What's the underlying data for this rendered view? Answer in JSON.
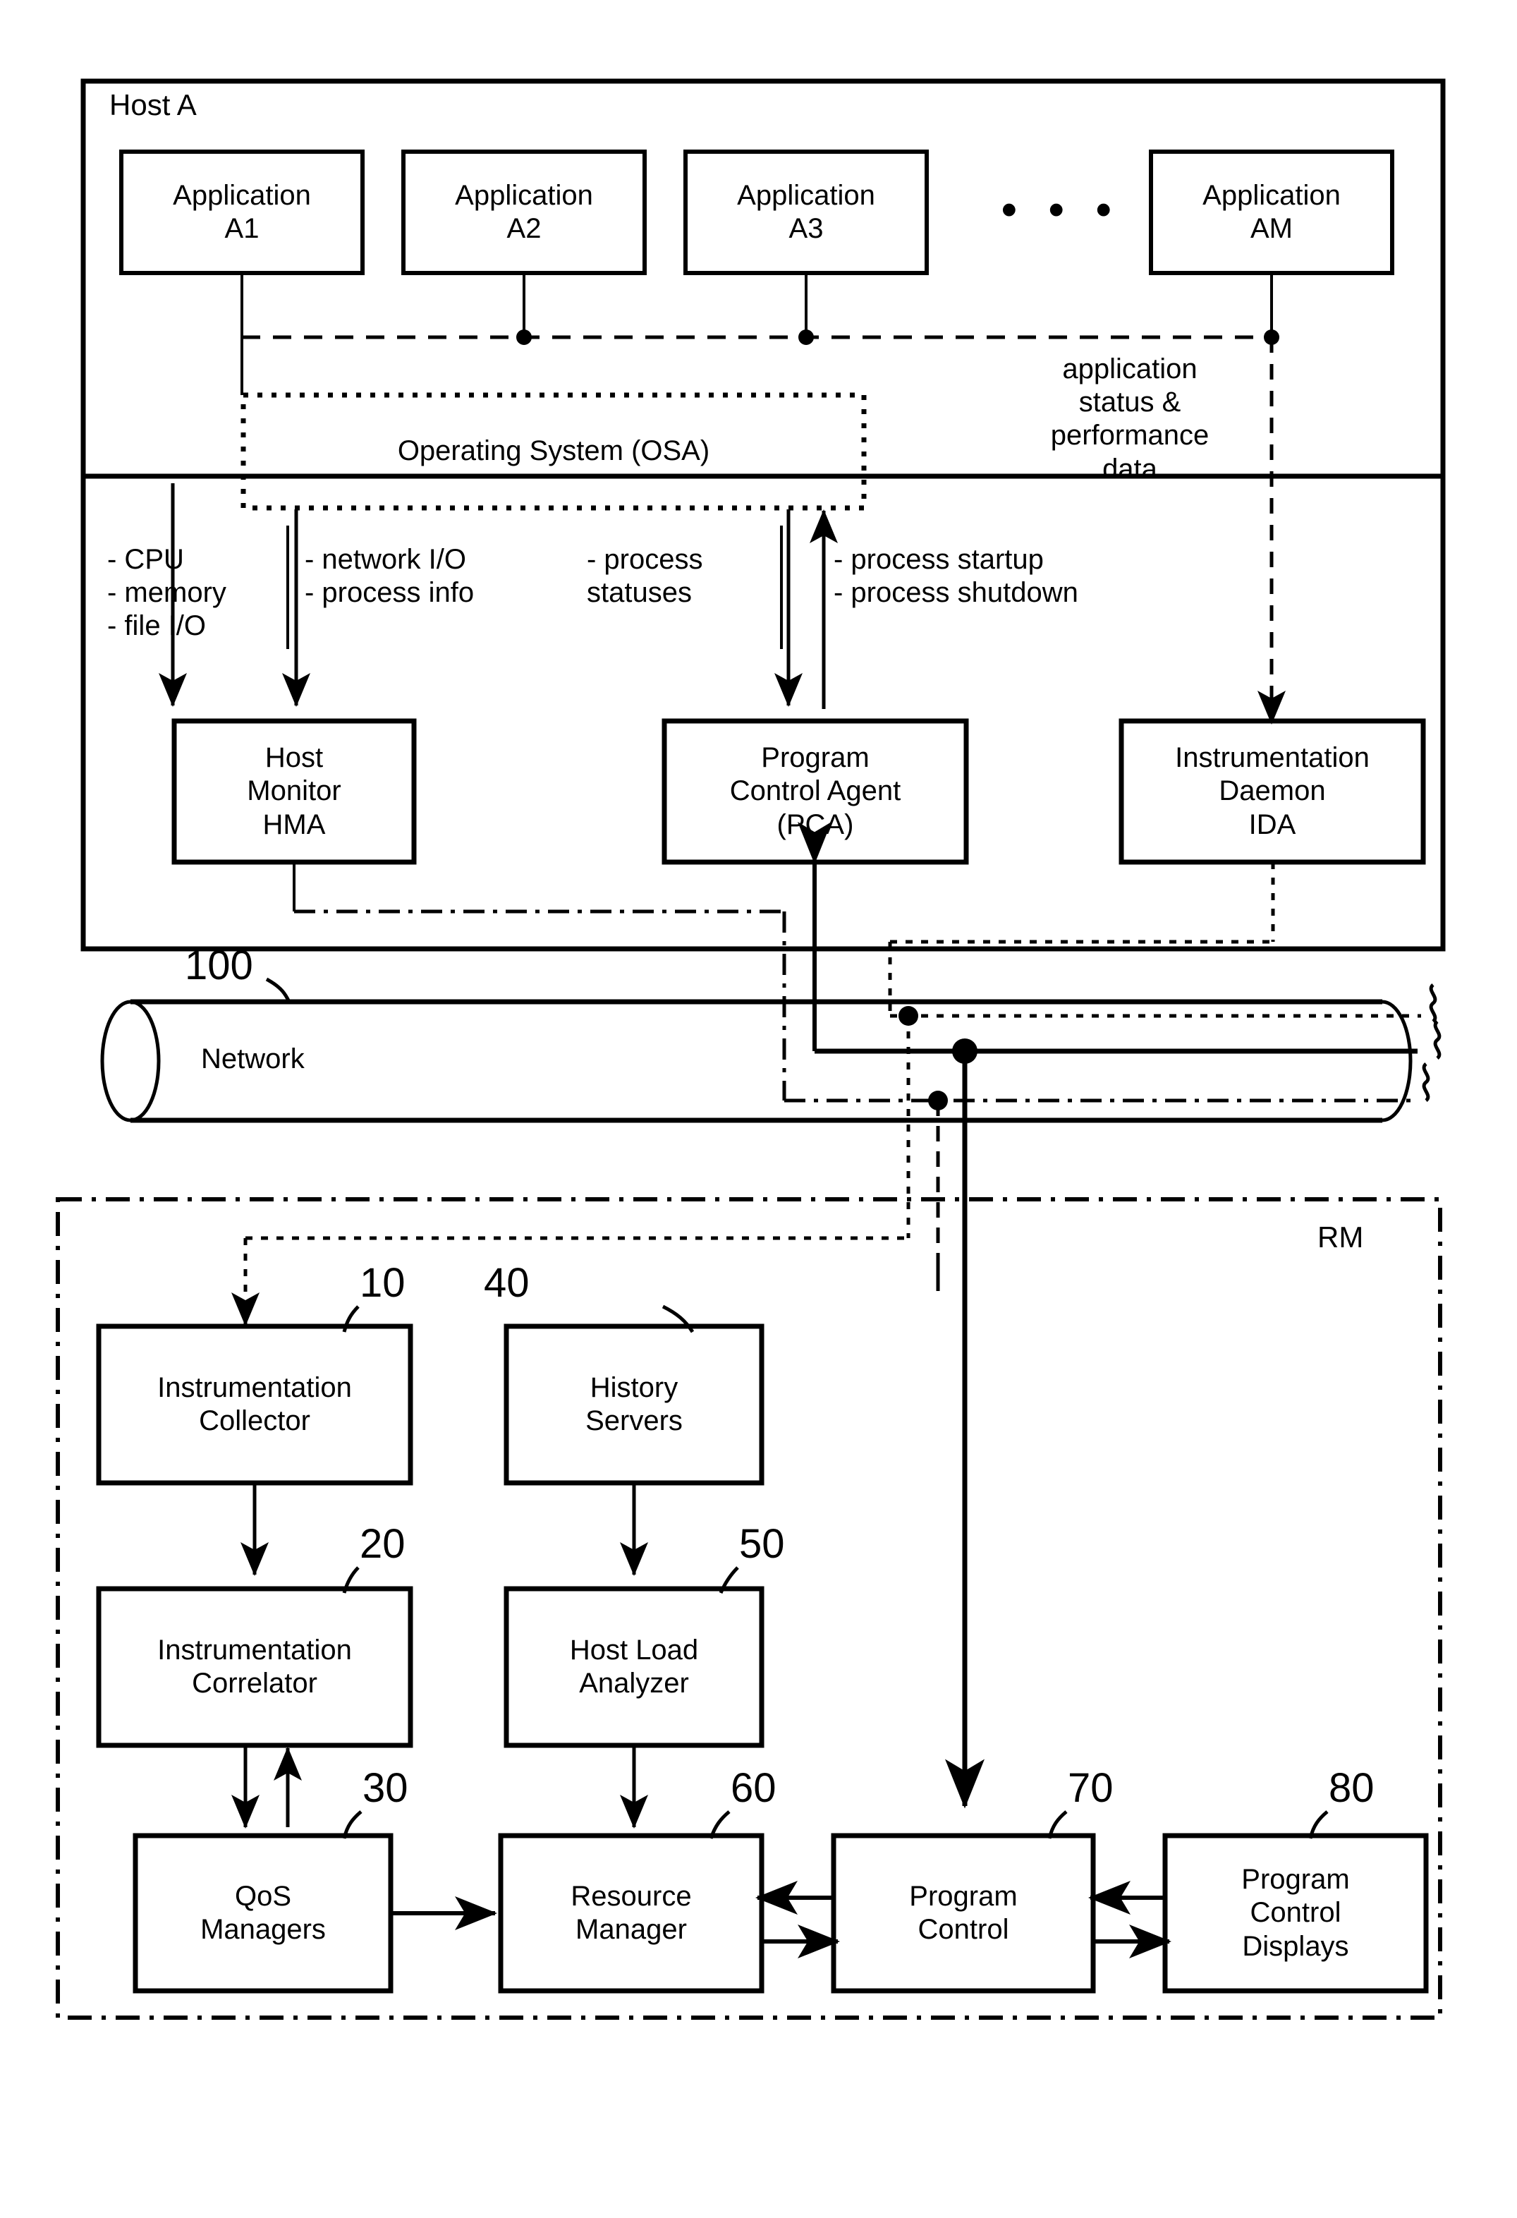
{
  "figure": {
    "host_label": "Host A",
    "rm_label": "RM",
    "network_label": "Network",
    "network_ref": "100",
    "ellipsis": "• • •"
  },
  "applications": [
    {
      "name": "app-a1",
      "label": "Application\nA1"
    },
    {
      "name": "app-a2",
      "label": "Application\nA2"
    },
    {
      "name": "app-a3",
      "label": "Application\nA3"
    },
    {
      "name": "app-am",
      "label": "Application\nAM"
    }
  ],
  "os": {
    "label": "Operating System (OSA)"
  },
  "host_agents": [
    {
      "name": "host-monitor",
      "label": "Host\nMonitor\nHMA"
    },
    {
      "name": "program-control-agent",
      "label": "Program\nControl Agent\n(PCA)"
    },
    {
      "name": "instrumentation-daemon",
      "label": "Instrumentation\nDaemon\nIDA"
    }
  ],
  "annotations": {
    "resources": "- CPU\n- memory\n- file I/O",
    "network_io": "- network I/O\n- process info",
    "process_statuses": "- process\n  statuses",
    "process_control": "- process startup\n- process shutdown",
    "app_status": "application\nstatus &\nperformance\ndata"
  },
  "rm_blocks": [
    {
      "name": "instrumentation-collector",
      "label": "Instrumentation\nCollector",
      "ref": "10"
    },
    {
      "name": "history-servers",
      "label": "History\nServers",
      "ref": "40"
    },
    {
      "name": "instrumentation-correlator",
      "label": "Instrumentation\nCorrelator",
      "ref": "20"
    },
    {
      "name": "host-load-analyzer",
      "label": "Host Load\nAnalyzer",
      "ref": "50"
    },
    {
      "name": "qos-managers",
      "label": "QoS\nManagers",
      "ref": "30"
    },
    {
      "name": "resource-manager",
      "label": "Resource\nManager",
      "ref": "60"
    },
    {
      "name": "program-control",
      "label": "Program\nControl",
      "ref": "70"
    },
    {
      "name": "program-control-displays",
      "label": "Program\nControl\nDisplays",
      "ref": "80"
    }
  ],
  "colors": {
    "stroke": "#000000",
    "background": "#ffffff"
  }
}
